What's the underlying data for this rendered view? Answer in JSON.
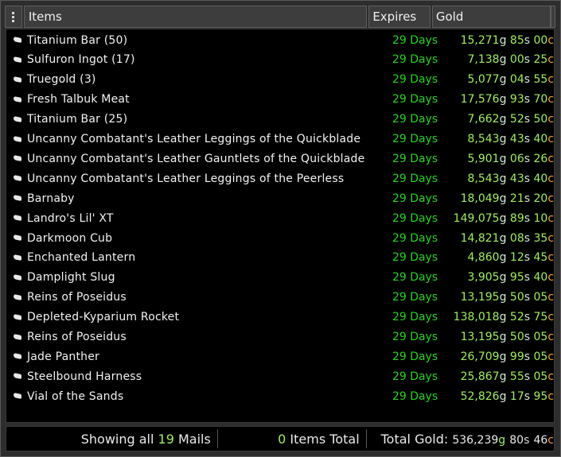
{
  "header": {
    "items_label": "Items",
    "expires_label": "Expires",
    "gold_label": "Gold"
  },
  "rows": [
    {
      "name": "Titanium Bar (50)",
      "expires": "29 Days",
      "g": "15,271",
      "s": "85",
      "c": "00"
    },
    {
      "name": "Sulfuron Ingot (17)",
      "expires": "29 Days",
      "g": "7,138",
      "s": "00",
      "c": "25"
    },
    {
      "name": "Truegold (3)",
      "expires": "29 Days",
      "g": "5,077",
      "s": "04",
      "c": "55"
    },
    {
      "name": "Fresh Talbuk Meat",
      "expires": "29 Days",
      "g": "17,576",
      "s": "93",
      "c": "70"
    },
    {
      "name": "Titanium Bar (25)",
      "expires": "29 Days",
      "g": "7,662",
      "s": "52",
      "c": "50"
    },
    {
      "name": "Uncanny Combatant's Leather Leggings of the Quickblade",
      "expires": "29 Days",
      "g": "8,543",
      "s": "43",
      "c": "40"
    },
    {
      "name": "Uncanny Combatant's Leather Gauntlets of the Quickblade",
      "expires": "29 Days",
      "g": "5,901",
      "s": "06",
      "c": "26"
    },
    {
      "name": "Uncanny Combatant's Leather Leggings of the Peerless",
      "expires": "29 Days",
      "g": "8,543",
      "s": "43",
      "c": "40"
    },
    {
      "name": "Barnaby",
      "expires": "29 Days",
      "g": "18,049",
      "s": "21",
      "c": "20"
    },
    {
      "name": "Landro's Lil' XT",
      "expires": "29 Days",
      "g": "149,075",
      "s": "89",
      "c": "10"
    },
    {
      "name": "Darkmoon Cub",
      "expires": "29 Days",
      "g": "14,821",
      "s": "08",
      "c": "35"
    },
    {
      "name": "Enchanted Lantern",
      "expires": "29 Days",
      "g": "4,860",
      "s": "12",
      "c": "45"
    },
    {
      "name": "Damplight Slug",
      "expires": "29 Days",
      "g": "3,905",
      "s": "95",
      "c": "40"
    },
    {
      "name": "Reins of Poseidus",
      "expires": "29 Days",
      "g": "13,195",
      "s": "50",
      "c": "05"
    },
    {
      "name": "Depleted-Kyparium Rocket",
      "expires": "29 Days",
      "g": "138,018",
      "s": "52",
      "c": "75"
    },
    {
      "name": "Reins of Poseidus",
      "expires": "29 Days",
      "g": "13,195",
      "s": "50",
      "c": "05"
    },
    {
      "name": "Jade Panther",
      "expires": "29 Days",
      "g": "26,709",
      "s": "99",
      "c": "05"
    },
    {
      "name": "Steelbound Harness",
      "expires": "29 Days",
      "g": "25,867",
      "s": "55",
      "c": "05"
    },
    {
      "name": "Vial of the Sands",
      "expires": "29 Days",
      "g": "52,826",
      "s": "17",
      "c": "95"
    }
  ],
  "units": {
    "g": "g",
    "s": "s",
    "c": "c"
  },
  "footer": {
    "showing_prefix": "Showing all",
    "mail_count": "19",
    "mails_suffix": "Mails",
    "items_count": "0",
    "items_suffix": "Items Total",
    "total_label": "Total Gold:",
    "total_g": "536,239",
    "total_s": "80",
    "total_c": "46"
  },
  "colors": {
    "expires_green": "#21d41d",
    "gold_green": "#9ff05a",
    "copper_orange": "#f0a030"
  }
}
